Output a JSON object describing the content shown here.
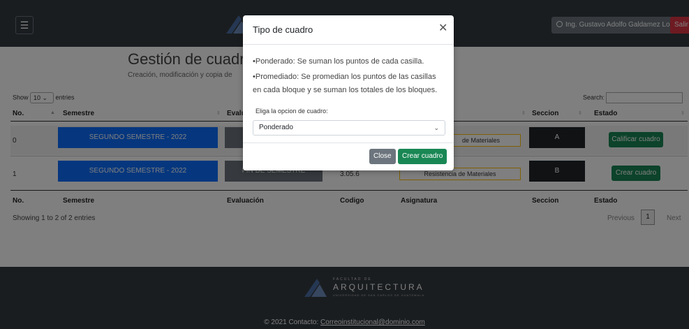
{
  "header": {
    "menu_icon": "hamburger-icon",
    "user_label": "Ing. Gustavo Adolfo Galdamez Lopez",
    "user_icon": "user-circle-icon",
    "logout_label": "Salir"
  },
  "page": {
    "title": "Gestión de cuadr",
    "subtitle": "Creación, modificación y copia de"
  },
  "table_controls": {
    "show_label": "Show",
    "length_value": "10",
    "entries_label": "entries",
    "search_label": "Search:"
  },
  "table": {
    "columns": [
      "No.",
      "Semestre",
      "Evalu",
      "Seccion",
      "Estado"
    ],
    "footer_columns": [
      "No.",
      "Semestre",
      "Evaluación",
      "Codigo",
      "Asignatura",
      "Seccion",
      "Estado"
    ],
    "rows": [
      {
        "no": "0",
        "semestre": "SEGUNDO SEMESTRE - 2022",
        "evaluacion": "",
        "codigo": "",
        "asignatura": "de Materiales",
        "seccion": "A",
        "accion": "Calificar cuadro"
      },
      {
        "no": "1",
        "semestre": "SEGUNDO SEMESTRE - 2022",
        "evaluacion": "FIN DE SEMESTRE",
        "codigo": "3.05.6",
        "asignatura": "Resistencia de Materiales",
        "seccion": "B",
        "accion": "Crear cuadro"
      }
    ],
    "info": "Showing 1 to 2 of 2 entries",
    "pager": {
      "previous": "Previous",
      "page": "1",
      "next": "Next"
    }
  },
  "footer": {
    "brand_small": "FACULTAD DE",
    "brand": "ARQUITECTURA",
    "brand_line": "UNIVERSIDAD DE SAN CARLOS DE GUATEMALA",
    "copyright": "© 2021 Contacto:",
    "email": "Correoinstitucional@dominio.com"
  },
  "modal": {
    "title": "Tipo de cuadro",
    "close_icon": "close-icon",
    "line1": "•Ponderado: Se suman los puntos de cada casilla.",
    "line2": "•Promediado: Se promedian los puntos de las casillas",
    "line3": "en cada bloque y se suman los totales de los bloques.",
    "select_label": "Eliga la opcion de cuadro:",
    "select_value": "Ponderado",
    "close_button": "Close",
    "create_button": "Crear cuadro"
  },
  "colors": {
    "primary": "#0d6efd",
    "success": "#198754",
    "secondary": "#6c757d",
    "danger": "#dc3545",
    "dark": "#343a40",
    "warning": "#ffc107"
  }
}
